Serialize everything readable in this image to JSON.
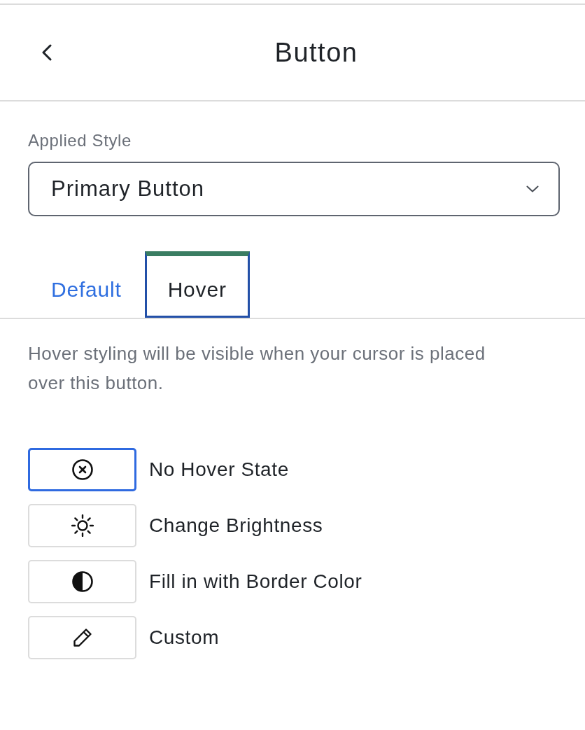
{
  "header": {
    "title": "Button"
  },
  "applied_style": {
    "label": "Applied Style",
    "value": "Primary Button"
  },
  "tabs": [
    {
      "label": "Default",
      "selected": false
    },
    {
      "label": "Hover",
      "selected": true
    }
  ],
  "description": "Hover styling will be visible when your cursor is placed over this button.",
  "hover_options": [
    {
      "kind": "none",
      "label": "No Hover State",
      "selected": true
    },
    {
      "kind": "brightness",
      "label": "Change Brightness",
      "selected": false
    },
    {
      "kind": "fill",
      "label": "Fill in with Border Color",
      "selected": false
    },
    {
      "kind": "custom",
      "label": "Custom",
      "selected": false
    }
  ]
}
